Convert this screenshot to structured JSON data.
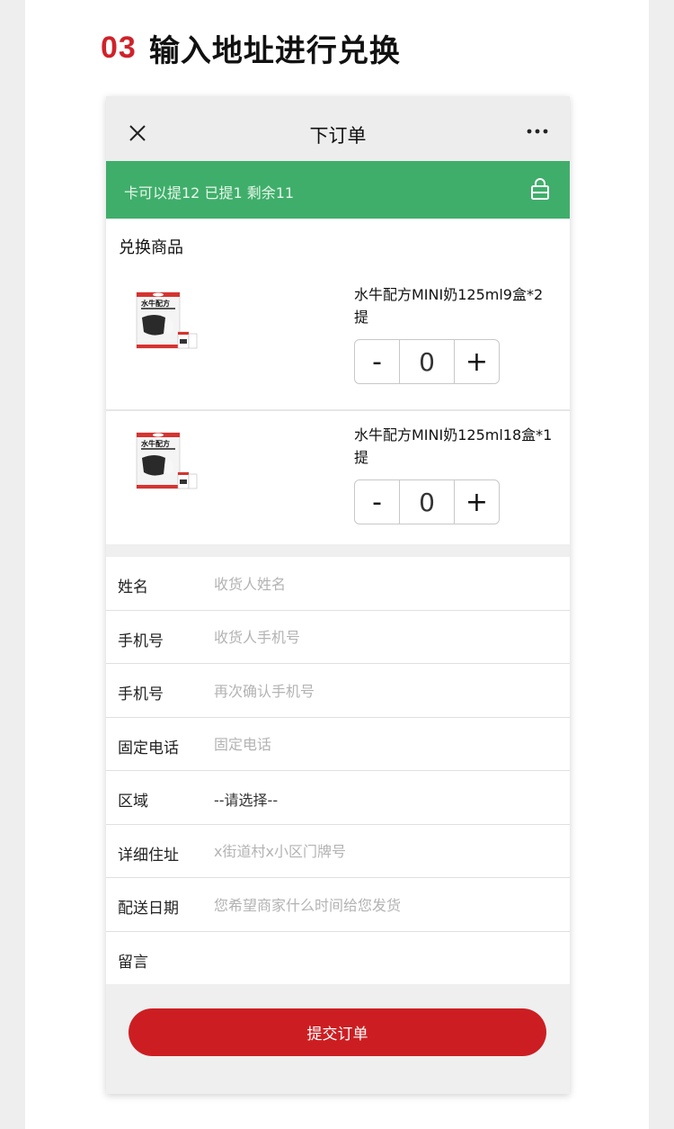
{
  "heading": {
    "number": "03",
    "title": "输入地址进行兑换"
  },
  "navbar": {
    "title": "下订单",
    "close_icon": "close-icon",
    "more_icon": "more-icon"
  },
  "quota_bar": {
    "text": "卡可以提12  已提1  剩余11",
    "icon": "shopping-bag-icon",
    "color": "#3fae6a"
  },
  "goods": {
    "section_label": "兑换商品",
    "items": [
      {
        "name": "水牛配方MINI奶125ml9盒*2提",
        "quantity": "0",
        "minus": "-",
        "plus": "+",
        "package_text": "水牛配方"
      },
      {
        "name": "水牛配方MINI奶125ml18盒*1提",
        "quantity": "0",
        "minus": "-",
        "plus": "+",
        "package_text": "水牛配方"
      }
    ]
  },
  "form": {
    "rows": [
      {
        "label": "姓名",
        "placeholder": "收货人姓名"
      },
      {
        "label": "手机号",
        "placeholder": "收货人手机号"
      },
      {
        "label": "手机号",
        "placeholder": "再次确认手机号"
      },
      {
        "label": "固定电话",
        "placeholder": "固定电话"
      },
      {
        "label": "区域",
        "value": "--请选择--"
      },
      {
        "label": "详细住址",
        "placeholder": "x街道村x小区门牌号"
      },
      {
        "label": "配送日期",
        "placeholder": "您希望商家什么时间给您发货"
      },
      {
        "label": "留言",
        "placeholder": ""
      }
    ]
  },
  "submit": {
    "label": "提交订单",
    "color": "#cc1e22"
  }
}
